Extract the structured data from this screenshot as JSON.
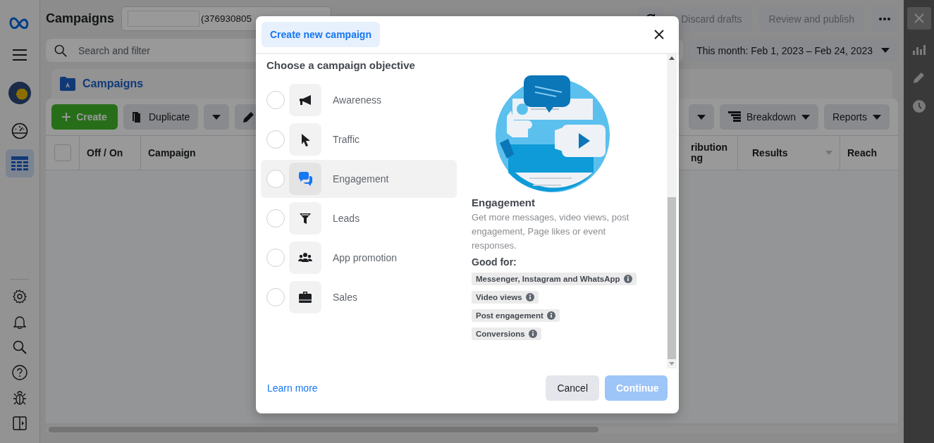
{
  "sidebar": {
    "top": [
      {
        "kind": "logo"
      },
      {
        "kind": "menu"
      },
      {
        "kind": "avatar"
      },
      {
        "kind": "dashboard",
        "selected": false
      },
      {
        "kind": "table",
        "selected": true
      }
    ],
    "bottom": [
      {
        "kind": "settings"
      },
      {
        "kind": "bell"
      },
      {
        "kind": "search"
      },
      {
        "kind": "help"
      },
      {
        "kind": "bug"
      },
      {
        "kind": "panel"
      }
    ]
  },
  "header": {
    "title": "Campaigns",
    "account_id": "(376930805",
    "buttons": [
      "Discard drafts",
      "Review and publish"
    ]
  },
  "search": {
    "placeholder": "Search and filter"
  },
  "date_range": "This month: Feb 1, 2023 – Feb 24, 2023",
  "tab": {
    "label": "Campaigns"
  },
  "toolbar": {
    "create": "Create",
    "duplicate": "Duplicate",
    "breakdown": "Breakdown",
    "reports": "Reports"
  },
  "table": {
    "select_all": {
      "checked": false
    },
    "columns": [
      "Off / On",
      "Campaign",
      "ribution ng",
      "Results",
      "Reach"
    ]
  },
  "modal": {
    "tab": "Create new campaign",
    "heading": "Choose a campaign objective",
    "objectives": [
      {
        "label": "Awareness",
        "kind": "megaphone",
        "selected": false
      },
      {
        "label": "Traffic",
        "kind": "cursor",
        "selected": false
      },
      {
        "label": "Engagement",
        "kind": "chat",
        "selected": true
      },
      {
        "label": "Leads",
        "kind": "funnel",
        "selected": false
      },
      {
        "label": "App promotion",
        "kind": "people",
        "selected": false
      },
      {
        "label": "Sales",
        "kind": "bag",
        "selected": false
      }
    ],
    "detail": {
      "title": "Engagement",
      "description": "Get more messages, video views, post engagement, Page likes or event responses.",
      "good_for": "Good for:",
      "tags": [
        "Messenger, Instagram and WhatsApp",
        "Video views",
        "Post engagement",
        "Conversions"
      ]
    },
    "learn_more": "Learn more",
    "cancel": "Cancel",
    "continue": {
      "label": "Continue",
      "disabled": true
    }
  }
}
